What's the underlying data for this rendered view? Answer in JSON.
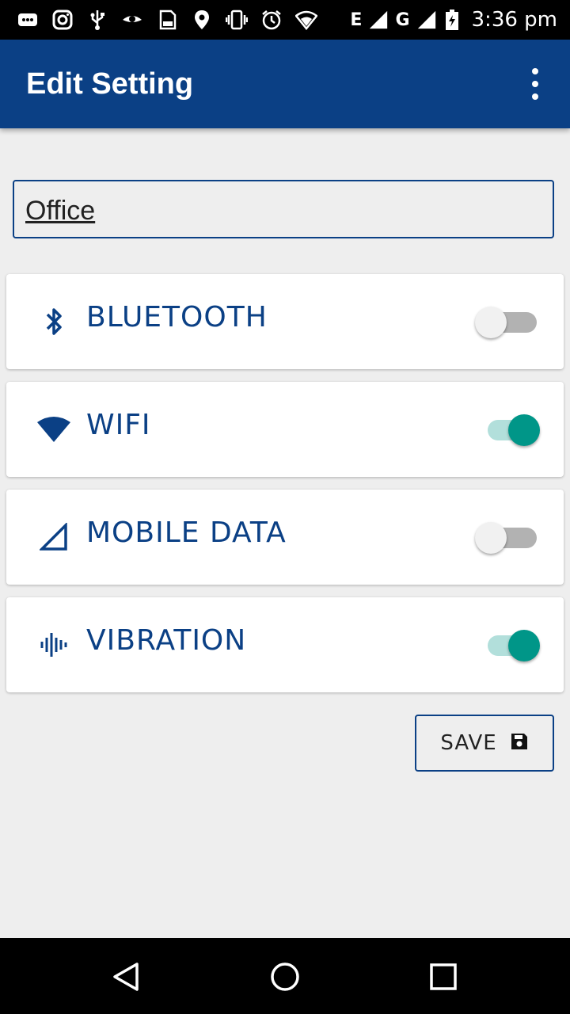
{
  "status_bar": {
    "network_e": "E",
    "network_g": "G",
    "time": "3:36 pm",
    "icons": [
      "message-icon",
      "instagram-icon",
      "usb-icon",
      "eye-icon",
      "sd-card-icon",
      "location-icon",
      "vibrate-icon",
      "alarm-icon",
      "wifi-icon",
      "signal-icon",
      "signal-icon",
      "battery-charging-icon"
    ]
  },
  "app_bar": {
    "title": "Edit Setting",
    "menu_icon": "more-vert-icon"
  },
  "profile_name": {
    "value": "Office"
  },
  "settings": [
    {
      "label": "BLUETOOTH",
      "icon": "bluetooth-icon",
      "enabled": false
    },
    {
      "label": "WIFI",
      "icon": "wifi-icon",
      "enabled": true
    },
    {
      "label": "MOBILE DATA",
      "icon": "signal-icon",
      "enabled": false
    },
    {
      "label": "VIBRATION",
      "icon": "vibration-icon",
      "enabled": true
    }
  ],
  "save_button": {
    "label": "SAVE",
    "icon": "save-icon"
  },
  "nav_bar": {
    "icons": [
      "back-icon",
      "home-icon",
      "recents-icon"
    ]
  },
  "colors": {
    "primary": "#0b4085",
    "accent": "#009688",
    "background": "#eeeeee"
  }
}
